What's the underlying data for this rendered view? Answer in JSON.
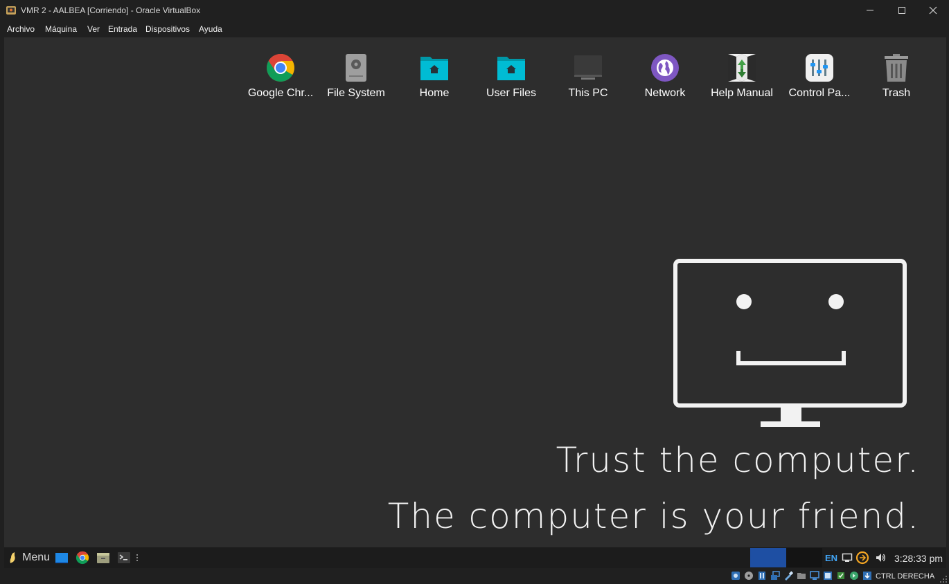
{
  "window": {
    "title": "VMR 2 - AALBEA [Corriendo] - Oracle VirtualBox",
    "controls": [
      "minimize-icon",
      "maximize-icon",
      "close-icon"
    ]
  },
  "menubar": {
    "items": [
      "Archivo",
      "Máquina",
      "Ver",
      "Entrada",
      "Dispositivos",
      "Ayuda"
    ]
  },
  "desktop": {
    "icons": [
      {
        "label": "Google Chr...",
        "icon": "chrome-icon"
      },
      {
        "label": "File System",
        "icon": "hard-drive-icon"
      },
      {
        "label": "Home",
        "icon": "home-folder-icon"
      },
      {
        "label": "User Files",
        "icon": "user-folder-icon"
      },
      {
        "label": "This PC",
        "icon": "monitor-icon"
      },
      {
        "label": "Network",
        "icon": "network-globe-icon"
      },
      {
        "label": "Help Manual",
        "icon": "help-manual-icon"
      },
      {
        "label": "Control Pa...",
        "icon": "control-panel-icon"
      },
      {
        "label": "Trash",
        "icon": "trash-icon"
      }
    ],
    "wallpaper": {
      "line1": "Trust the computer.",
      "line2": "The computer is your friend."
    }
  },
  "taskbar": {
    "menu_label": "Menu",
    "language": "EN",
    "clock": "3:28:33 pm",
    "accent_color": "#1e4fa3"
  },
  "statusbar": {
    "host_key": "CTRL DERECHA"
  }
}
